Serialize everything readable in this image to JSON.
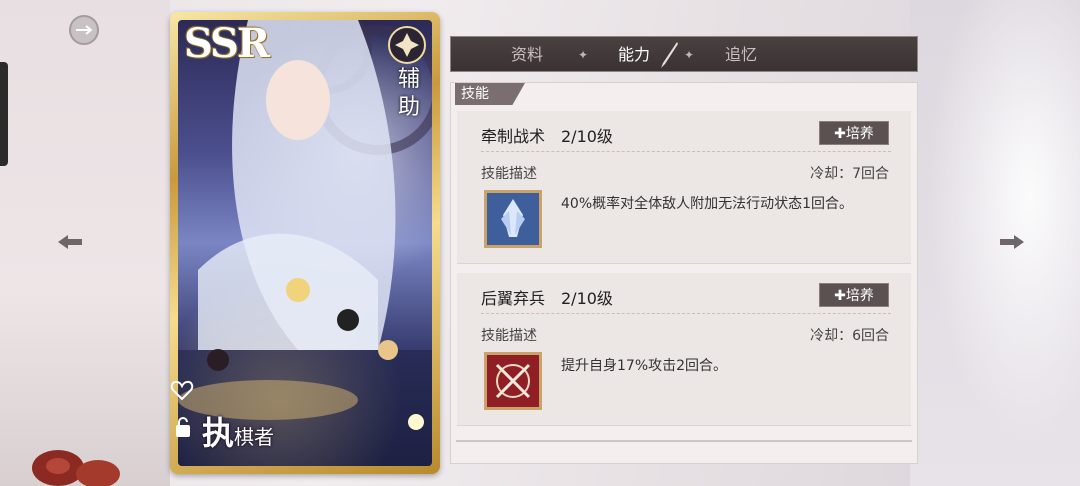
{
  "colors": {
    "tab_bar": "#3a3233",
    "content_bg": "#f4efee",
    "train_button": "#5a5150",
    "card_gold": "#c99a3c"
  },
  "card": {
    "rarity": "SSR",
    "role": "辅助",
    "name_big": "执",
    "name_small": "棋者",
    "icons": [
      "heart-icon",
      "lock-icon",
      "role-emblem-icon"
    ]
  },
  "tabs": [
    {
      "label": "资料"
    },
    {
      "label": "能力"
    },
    {
      "label": "追忆"
    }
  ],
  "active_tab": "能力",
  "section_label": "技能",
  "skills": [
    {
      "name": "牵制战术",
      "level": "2/10级",
      "train_label": "培养",
      "desc_label": "技能描述",
      "cooldown": "冷却：7回合",
      "description": "40%概率对全体敌人附加无法行动状态1回合。",
      "icon": "crystal-icon"
    },
    {
      "name": "后翼弃兵",
      "level": "2/10级",
      "train_label": "培养",
      "desc_label": "技能描述",
      "cooldown": "冷却：6回合",
      "description": "提升自身17%攻击2回合。",
      "icon": "crossed-swords-icon"
    }
  ]
}
